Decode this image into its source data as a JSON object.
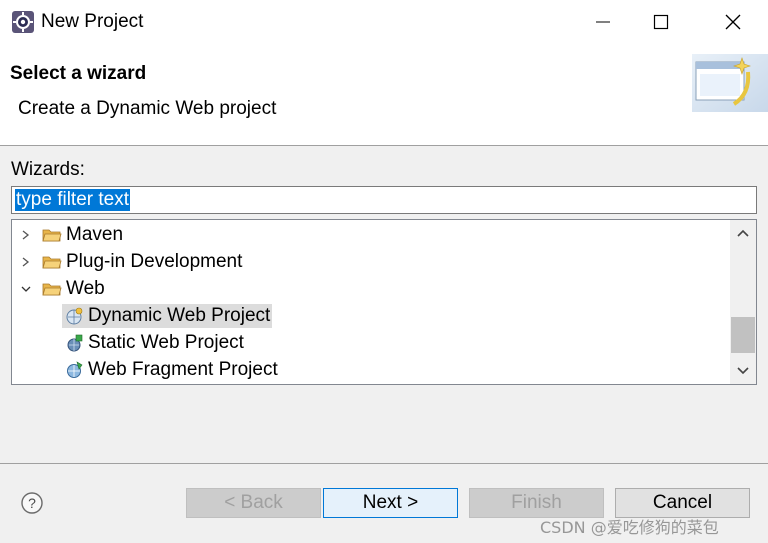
{
  "window": {
    "title": "New Project",
    "icon": "eclipse-gear-icon"
  },
  "header": {
    "title": "Select a wizard",
    "description": "Create a Dynamic Web project"
  },
  "wizards_label": "Wizards:",
  "filter": {
    "value": "type filter text",
    "selected": true
  },
  "tree": {
    "items": [
      {
        "label": "Maven",
        "level": 0,
        "expanded": false,
        "icon": "folder-icon"
      },
      {
        "label": "Plug-in Development",
        "level": 0,
        "expanded": false,
        "icon": "folder-icon"
      },
      {
        "label": "Web",
        "level": 0,
        "expanded": true,
        "icon": "folder-icon"
      },
      {
        "label": "Dynamic Web Project",
        "level": 1,
        "selected": true,
        "icon": "dynamic-web-project-icon"
      },
      {
        "label": "Static Web Project",
        "level": 1,
        "icon": "static-web-project-icon"
      },
      {
        "label": "Web Fragment Project",
        "level": 1,
        "icon": "web-fragment-project-icon"
      }
    ]
  },
  "buttons": {
    "back": "< Back",
    "next": "Next >",
    "finish": "Finish",
    "cancel": "Cancel"
  },
  "watermark": "CSDN @爱吃修狗的菜包",
  "colors": {
    "selection": "#0078d7",
    "tree_selection": "#dcdcdc",
    "dialog_bg": "#f0f0f0"
  }
}
